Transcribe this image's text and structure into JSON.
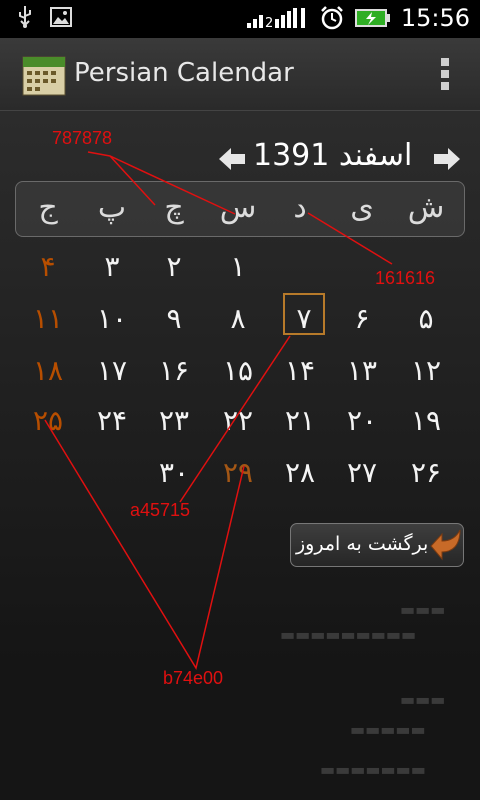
{
  "status_bar": {
    "time": "15:56",
    "icons": [
      "usb-icon",
      "image-icon",
      "signal-icon",
      "alarm-icon",
      "battery-icon"
    ]
  },
  "app_bar": {
    "title": "Persian Calendar",
    "icons": [
      "app-calendar-icon",
      "overflow-menu-icon"
    ]
  },
  "calendar": {
    "month_title": "اسفند 1391",
    "weekdays": [
      "ش",
      "ی",
      "د",
      "س",
      "چ",
      "پ",
      "ج"
    ],
    "weeks": [
      [
        "",
        "",
        "",
        "۱",
        "۲",
        "۳",
        "۴"
      ],
      [
        "۵",
        "۶",
        "۷",
        "۸",
        "۹",
        "۱۰",
        "۱۱"
      ],
      [
        "۱۲",
        "۱۳",
        "۱۴",
        "۱۵",
        "۱۶",
        "۱۷",
        "۱۸"
      ],
      [
        "۱۹",
        "۲۰",
        "۲۱",
        "۲۲",
        "۲۳",
        "۲۴",
        "۲۵"
      ],
      [
        "۲۶",
        "۲۷",
        "۲۸",
        "۲۹",
        "۳۰",
        "",
        ""
      ]
    ],
    "today": "۷",
    "back_to_today": "برگشت به امروز"
  },
  "annotations": [
    "787878",
    "161616",
    "a45715",
    "b74e00"
  ],
  "colors": {
    "friday": "#b74e00",
    "holiday": "#a45715",
    "background": "#161616",
    "weekday_bg": "#787878",
    "annotation": "#e01010"
  }
}
